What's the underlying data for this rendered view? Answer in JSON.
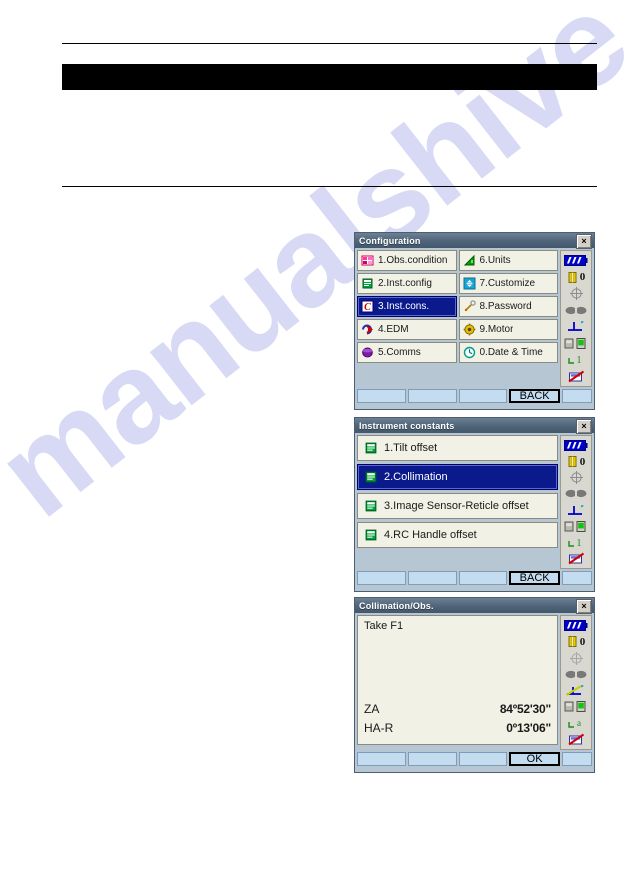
{
  "page": {
    "watermark_text": "manualshive",
    "redacted_heading": ""
  },
  "dialogs": [
    {
      "id": "configuration",
      "title": "Configuration",
      "close_label": "×",
      "layout": "grid2",
      "items": [
        {
          "label": "1.Obs.condition",
          "icon": "obs-condition-icon",
          "selected": false
        },
        {
          "label": "6.Units",
          "icon": "units-icon",
          "selected": false
        },
        {
          "label": "2.Inst.config",
          "icon": "inst-config-icon",
          "selected": false
        },
        {
          "label": "7.Customize",
          "icon": "customize-icon",
          "selected": false
        },
        {
          "label": "3.Inst.cons.",
          "icon": "inst-cons-icon",
          "selected": true
        },
        {
          "label": "8.Password",
          "icon": "password-icon",
          "selected": false
        },
        {
          "label": "4.EDM",
          "icon": "edm-icon",
          "selected": false
        },
        {
          "label": "9.Motor",
          "icon": "motor-icon",
          "selected": false
        },
        {
          "label": "5.Comms",
          "icon": "comms-icon",
          "selected": false
        },
        {
          "label": "0.Date & Time",
          "icon": "date-time-icon",
          "selected": false
        }
      ],
      "status": {
        "battery_level": "full",
        "target_count": "0",
        "tilt_state": "off"
      },
      "softkeys": [
        "",
        "",
        "",
        "BACK",
        ""
      ],
      "active_softkey_index": 3
    },
    {
      "id": "instrument-constants",
      "title": "Instrument constants",
      "close_label": "×",
      "layout": "grid1",
      "items": [
        {
          "label": "1.Tilt offset",
          "icon": "document-icon",
          "selected": false
        },
        {
          "label": "2.Collimation",
          "icon": "document-icon",
          "selected": true
        },
        {
          "label": "3.Image Sensor-Reticle offset",
          "icon": "document-icon",
          "selected": false
        },
        {
          "label": "4.RC Handle offset",
          "icon": "document-icon",
          "selected": false
        }
      ],
      "status": {
        "battery_level": "full",
        "target_count": "0",
        "tilt_state": "off"
      },
      "softkeys": [
        "",
        "",
        "",
        "BACK",
        ""
      ],
      "active_softkey_index": 3
    },
    {
      "id": "collimation-obs",
      "title": "Collimation/Obs.",
      "close_label": "×",
      "layout": "text",
      "prompt": "Take F1",
      "readings": [
        {
          "label": "ZA",
          "value": "84º52'30\""
        },
        {
          "label": "HA-R",
          "value": "0º13'06\""
        }
      ],
      "status": {
        "battery_level": "full",
        "target_count": "0",
        "tilt_state": "on"
      },
      "softkeys": [
        "",
        "",
        "",
        "OK",
        ""
      ],
      "active_softkey_index": 3
    }
  ],
  "colors": {
    "title_bar": "#4f6478",
    "selection": "#0a1a8c",
    "button_face": "#f2f1e6",
    "softkey": "#c3dcf0",
    "dialog_frame": "#b7c6d3",
    "watermark": "#d8daf5",
    "redaction": "#000000"
  }
}
